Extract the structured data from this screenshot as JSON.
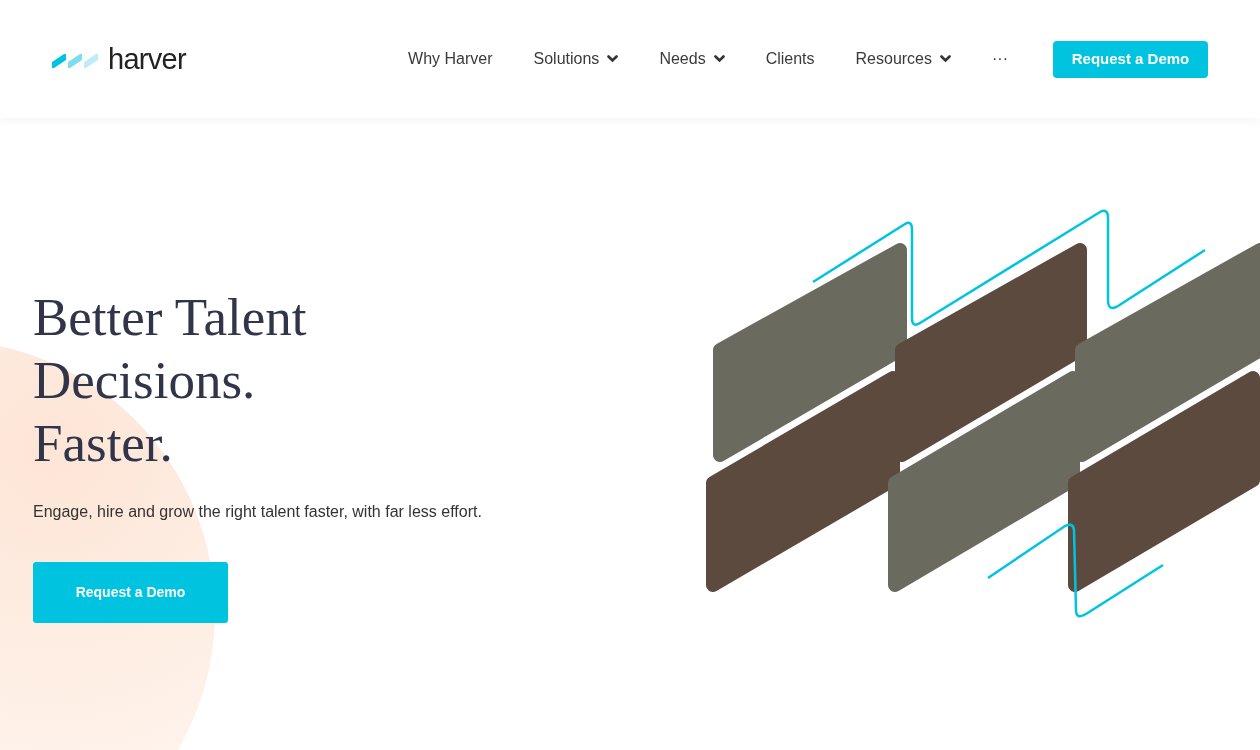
{
  "header": {
    "logo": {
      "wordmark": "harver"
    },
    "nav": [
      {
        "label": "Why Harver",
        "has_menu": false
      },
      {
        "label": "Solutions",
        "has_menu": true
      },
      {
        "label": "Needs",
        "has_menu": true
      },
      {
        "label": "Clients",
        "has_menu": false
      },
      {
        "label": "Resources",
        "has_menu": true
      },
      {
        "label": "···",
        "has_menu": false
      }
    ],
    "cta": "Request a Demo"
  },
  "hero": {
    "headline": [
      "Better Talent",
      "Decisions.",
      "Faster."
    ],
    "subtitle": "Engage, hire and grow the right talent faster, with far less effort.",
    "button": "Request a Demo"
  }
}
